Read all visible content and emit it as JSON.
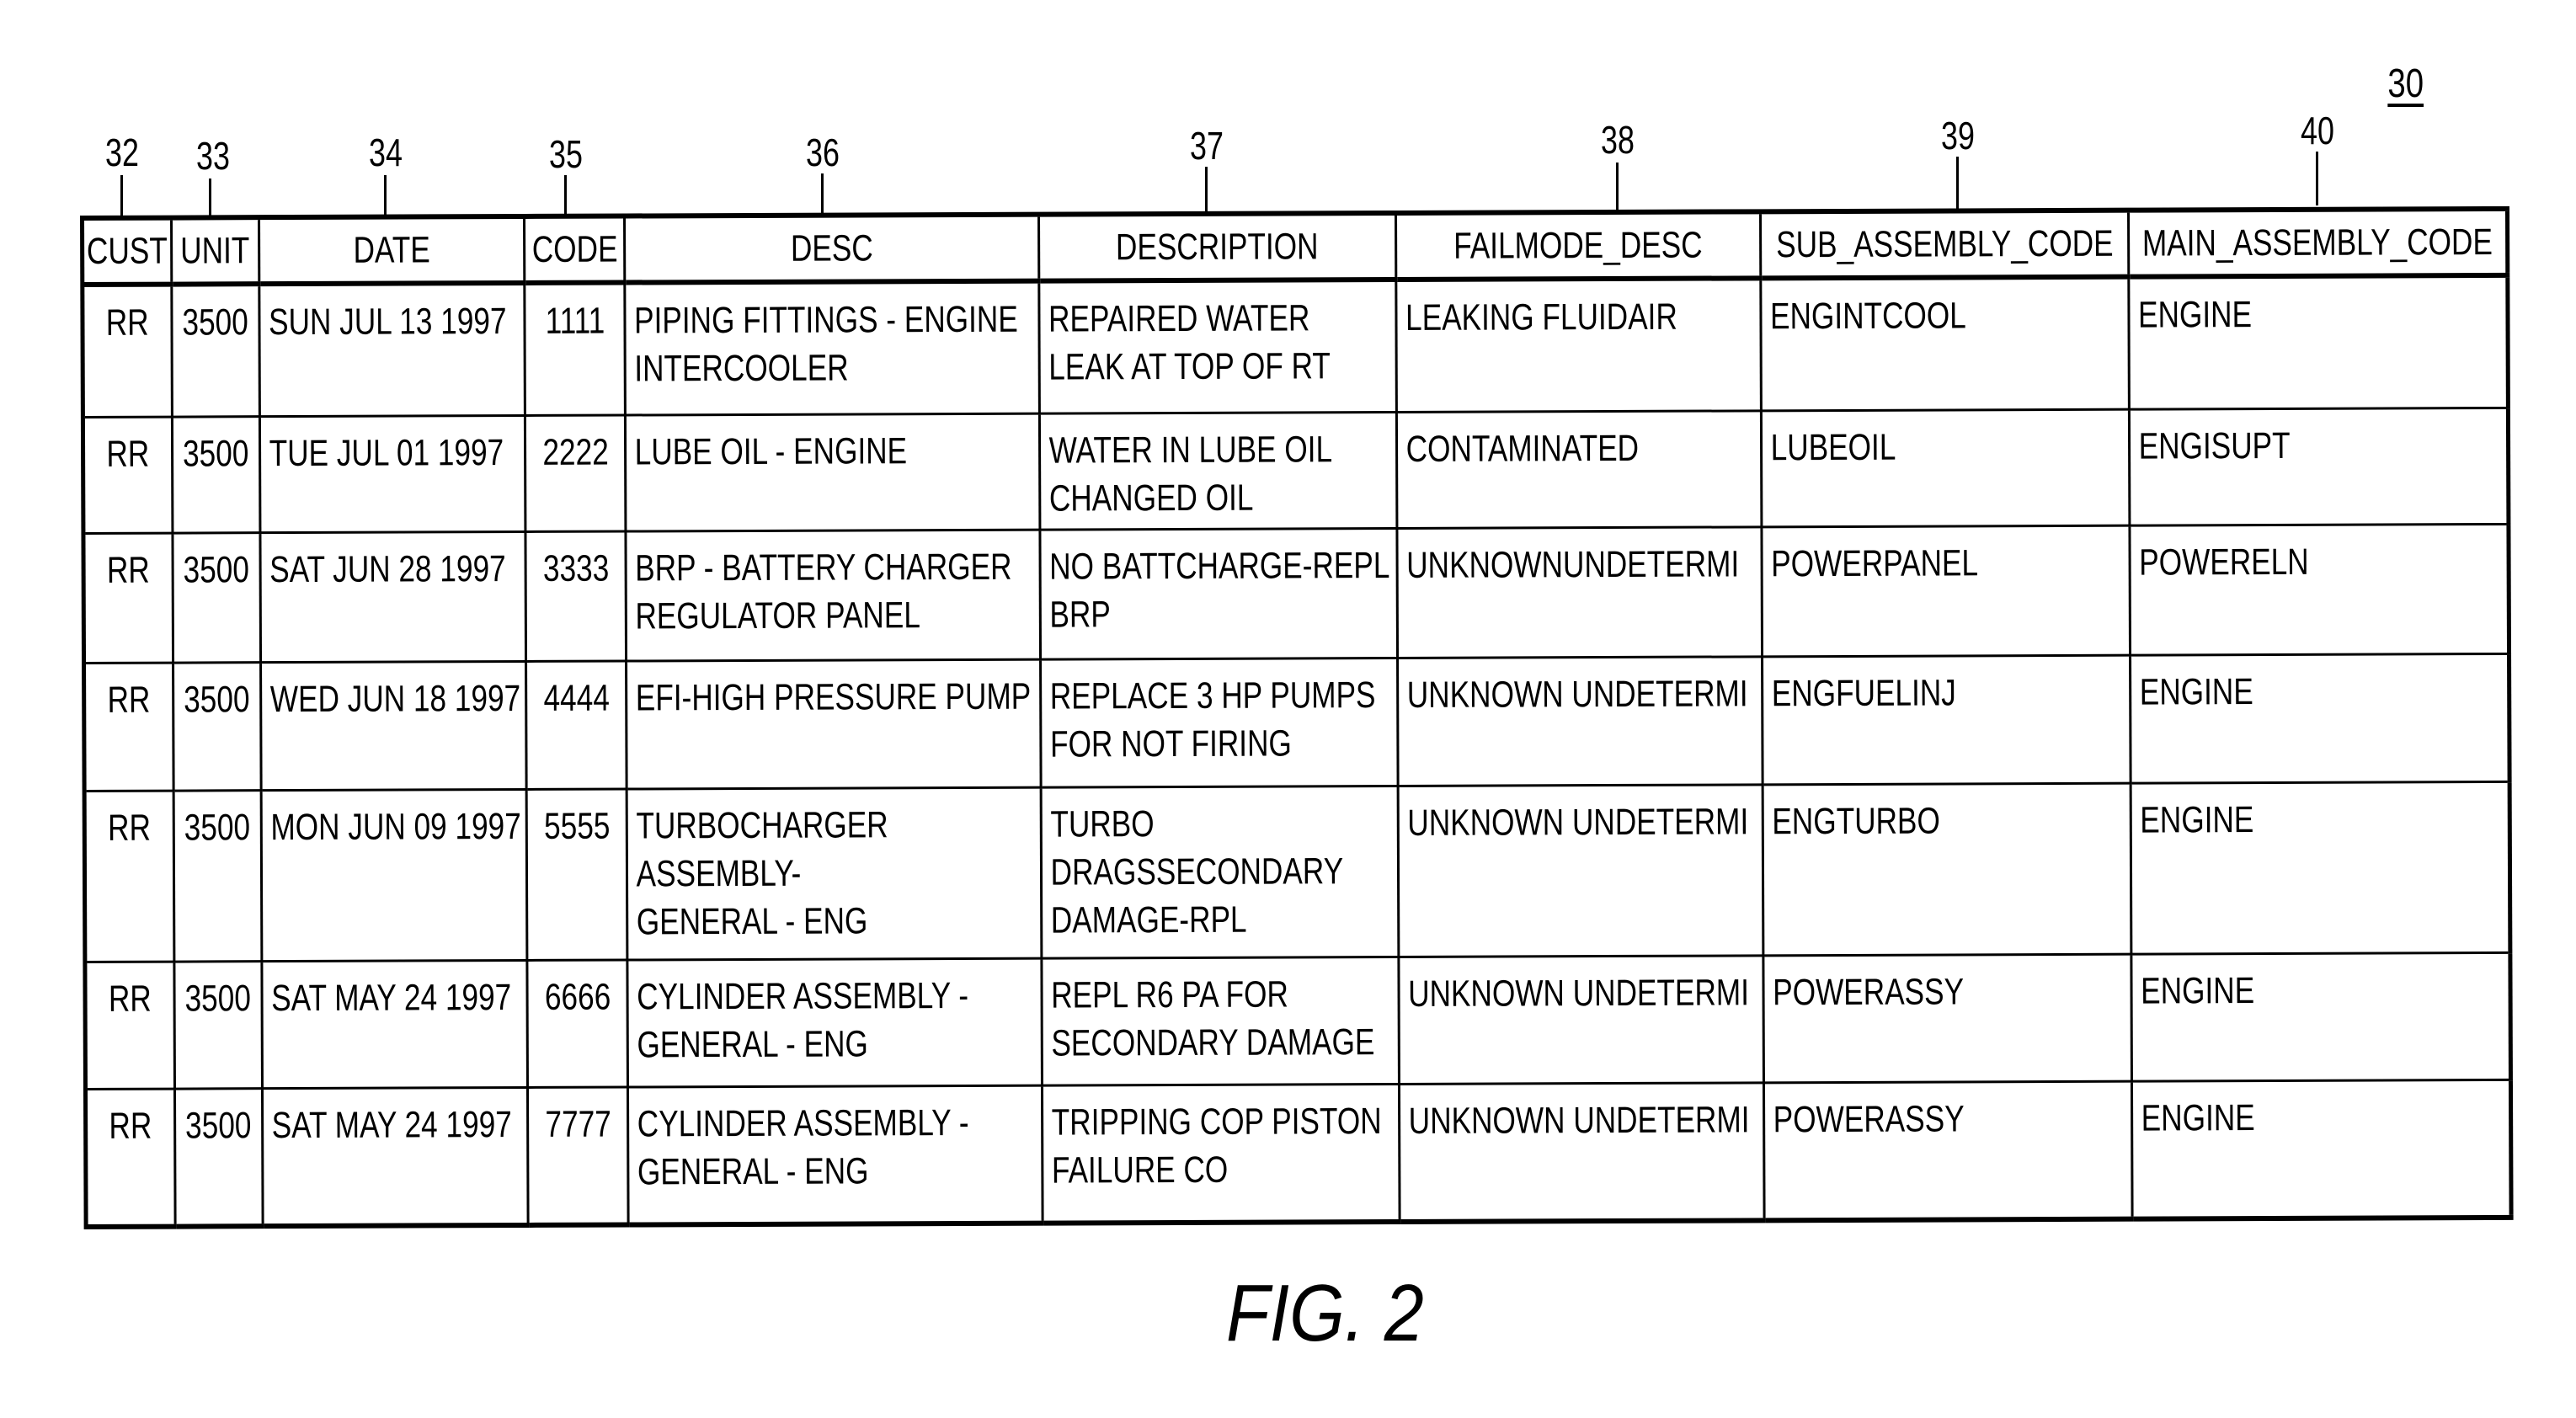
{
  "figure": {
    "reference_number": "30",
    "caption": "FIG. 2"
  },
  "columns": [
    {
      "ref": "32",
      "header": "CUST"
    },
    {
      "ref": "33",
      "header": "UNIT"
    },
    {
      "ref": "34",
      "header": "DATE"
    },
    {
      "ref": "35",
      "header": "CODE"
    },
    {
      "ref": "36",
      "header": "DESC"
    },
    {
      "ref": "37",
      "header": "DESCRIPTION"
    },
    {
      "ref": "38",
      "header": "FAILMODE_DESC"
    },
    {
      "ref": "39",
      "header": "SUB_ASSEMBLY_CODE"
    },
    {
      "ref": "40",
      "header": "MAIN_ASSEMBLY_CODE"
    }
  ],
  "rows": [
    {
      "cust": "RR",
      "unit": "3500",
      "date": "SUN JUL 13 1997",
      "code": "1111",
      "desc": "PIPING FITTINGS - ENGINE\nINTERCOOLER",
      "description": "REPAIRED WATER\nLEAK AT TOP OF RT",
      "failmode_desc": "LEAKING FLUIDAIR",
      "sub_assembly_code": "ENGINTCOOL",
      "main_assembly_code": "ENGINE"
    },
    {
      "cust": "RR",
      "unit": "3500",
      "date": "TUE JUL 01 1997",
      "code": "2222",
      "desc": "LUBE OIL - ENGINE",
      "description": "WATER IN LUBE OIL\nCHANGED OIL",
      "failmode_desc": "CONTAMINATED",
      "sub_assembly_code": "LUBEOIL",
      "main_assembly_code": "ENGISUPT"
    },
    {
      "cust": "RR",
      "unit": "3500",
      "date": "SAT JUN 28 1997",
      "code": "3333",
      "desc": "BRP - BATTERY CHARGER\nREGULATOR PANEL",
      "description": "NO BATTCHARGE-REPL\nBRP",
      "failmode_desc": "UNKNOWNUNDETERMI",
      "sub_assembly_code": "POWERPANEL",
      "main_assembly_code": "POWERELN"
    },
    {
      "cust": "RR",
      "unit": "3500",
      "date": "WED JUN 18 1997",
      "code": "4444",
      "desc": "EFI-HIGH PRESSURE PUMP",
      "description": "REPLACE 3 HP PUMPS\nFOR NOT FIRING",
      "failmode_desc": "UNKNOWN UNDETERMI",
      "sub_assembly_code": "ENGFUELINJ",
      "main_assembly_code": "ENGINE"
    },
    {
      "cust": "RR",
      "unit": "3500",
      "date": "MON JUN 09 1997",
      "code": "5555",
      "desc": "TURBOCHARGER ASSEMBLY-\nGENERAL - ENG",
      "description": "TURBO\nDRAGSSECONDARY\nDAMAGE-RPL",
      "failmode_desc": "UNKNOWN UNDETERMI",
      "sub_assembly_code": "ENGTURBO",
      "main_assembly_code": "ENGINE"
    },
    {
      "cust": "RR",
      "unit": "3500",
      "date": "SAT MAY 24 1997",
      "code": "6666",
      "desc": "CYLINDER ASSEMBLY -\nGENERAL - ENG",
      "description": "REPL R6 PA FOR\nSECONDARY DAMAGE",
      "failmode_desc": "UNKNOWN UNDETERMI",
      "sub_assembly_code": "POWERASSY",
      "main_assembly_code": "ENGINE"
    },
    {
      "cust": "RR",
      "unit": "3500",
      "date": "SAT MAY 24 1997",
      "code": "7777",
      "desc": "CYLINDER ASSEMBLY -\nGENERAL - ENG",
      "description": "TRIPPING COP PISTON\nFAILURE CO",
      "failmode_desc": "UNKNOWN UNDETERMI",
      "sub_assembly_code": "POWERASSY",
      "main_assembly_code": "ENGINE"
    }
  ]
}
